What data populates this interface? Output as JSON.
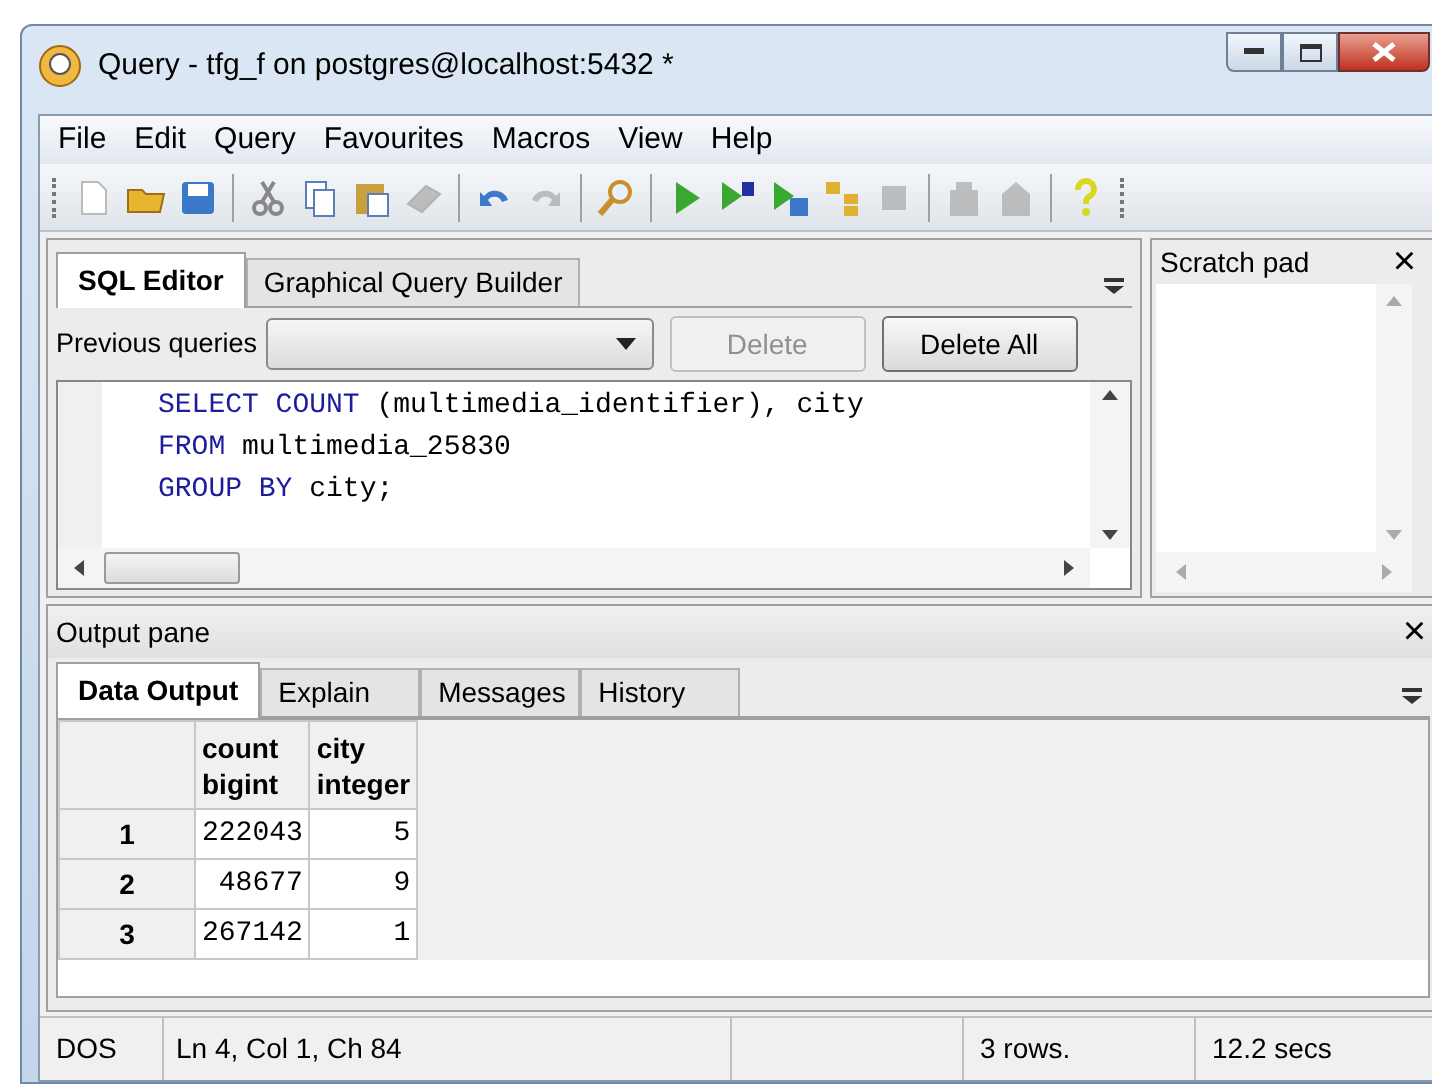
{
  "window": {
    "title": "Query - tfg_f on postgres@localhost:5432 *"
  },
  "menu": [
    "File",
    "Edit",
    "Query",
    "Favourites",
    "Macros",
    "View",
    "Help"
  ],
  "toolbar": [
    [
      {
        "disabled": false
      },
      {
        "disabled": false
      },
      {
        "disabled": false
      }
    ],
    [
      {
        "disabled": false
      },
      {
        "disabled": false
      },
      {
        "disabled": false
      },
      {
        "disabled": true
      }
    ],
    [
      {
        "disabled": false
      },
      {
        "disabled": true
      }
    ],
    [
      {
        "disabled": false
      }
    ],
    [
      {
        "disabled": false
      },
      {
        "disabled": false
      },
      {
        "disabled": false
      },
      {
        "disabled": false
      },
      {
        "disabled": true
      }
    ],
    [
      {
        "disabled": true
      },
      {
        "disabled": true
      }
    ],
    [
      {
        "disabled": false
      }
    ]
  ],
  "editor_tabs": [
    {
      "label": "SQL Editor",
      "selected": true
    },
    {
      "label": "Graphical Query Builder",
      "selected": false
    }
  ],
  "previous_queries": {
    "label": "Previous queries",
    "buttons": [
      {
        "label": "Delete",
        "disabled": true
      },
      {
        "label": "Delete All",
        "disabled": false
      }
    ]
  },
  "sql_lines": [
    [
      {
        "kind": "keyword",
        "text": "SELECT COUNT"
      },
      {
        "kind": "plain",
        "text": " (multimedia_identifier), city"
      }
    ],
    [
      {
        "kind": "keyword",
        "text": "FROM"
      },
      {
        "kind": "plain",
        "text": " multimedia_25830"
      }
    ],
    [
      {
        "kind": "keyword",
        "text": "GROUP BY"
      },
      {
        "kind": "plain",
        "text": " city;"
      }
    ]
  ],
  "scratch_pad": {
    "title": "Scratch pad",
    "close": "×"
  },
  "output_pane": {
    "title": "Output pane",
    "close": "×",
    "tabs": [
      {
        "label": "Data Output",
        "selected": true
      },
      {
        "label": "Explain",
        "selected": false
      },
      {
        "label": "Messages",
        "selected": false
      },
      {
        "label": "History",
        "selected": false
      }
    ],
    "table": {
      "columns": [
        {
          "name": "count",
          "type": "bigint"
        },
        {
          "name": "city",
          "type": "integer"
        }
      ],
      "rows": [
        {
          "index": "1",
          "cells": [
            "222043",
            "5"
          ]
        },
        {
          "index": "2",
          "cells": [
            "48677",
            "9"
          ]
        },
        {
          "index": "3",
          "cells": [
            "267142",
            "1"
          ]
        }
      ]
    }
  },
  "status_bar": {
    "encoding": "DOS",
    "position": "Ln 4, Col 1, Ch 84",
    "rows": "3 rows.",
    "time": "12.2 secs"
  }
}
